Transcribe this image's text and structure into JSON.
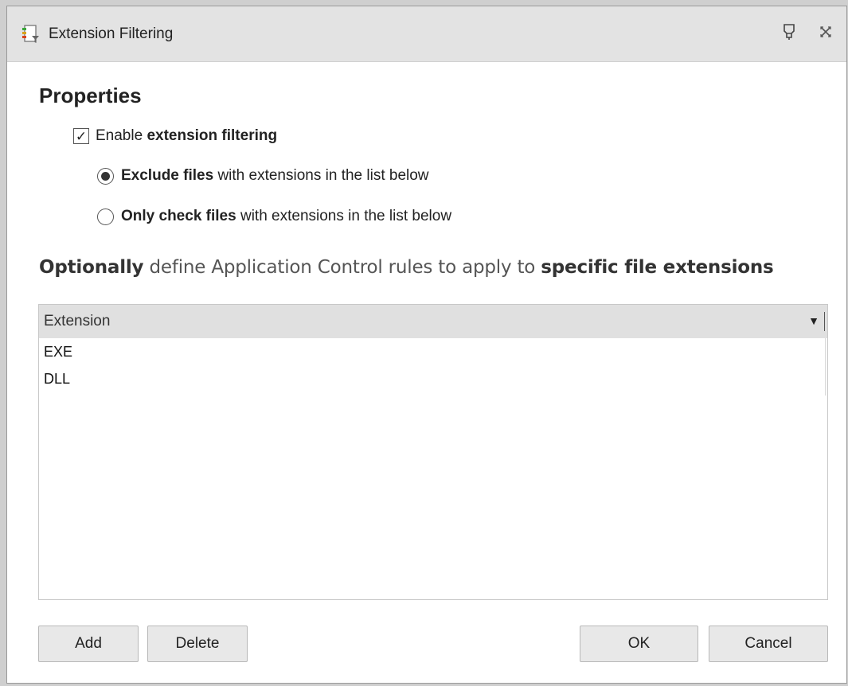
{
  "window": {
    "title": "Extension Filtering",
    "icons": {
      "app": "file-filter-icon",
      "pin": "pin-icon",
      "close": "close-icon"
    }
  },
  "properties": {
    "heading": "Properties",
    "enable_checkbox": {
      "prefix": "Enable ",
      "bold": "extension filtering",
      "checked": true
    },
    "radio_exclude": {
      "bold": "Exclude files",
      "rest": " with extensions in the list below",
      "selected": true
    },
    "radio_only": {
      "bold": "Only check files",
      "rest": " with extensions in the list below",
      "selected": false
    }
  },
  "optional": {
    "bold1": "Optionally",
    "mid": " define Application Control rules to apply to ",
    "bold2": "specific file extensions"
  },
  "grid": {
    "column": "Extension",
    "rows": [
      "EXE",
      "DLL"
    ]
  },
  "buttons": {
    "add": "Add",
    "delete": "Delete",
    "ok": "OK",
    "cancel": "Cancel"
  }
}
